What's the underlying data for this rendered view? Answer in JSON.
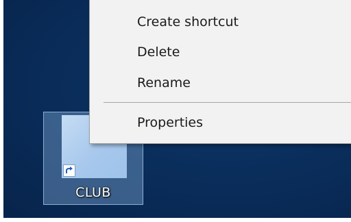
{
  "context_menu": {
    "items": [
      {
        "label": "Create shortcut"
      },
      {
        "label": "Delete"
      },
      {
        "label": "Rename"
      },
      {
        "label": "Properties"
      }
    ]
  },
  "desktop": {
    "icon": {
      "label": "CLUB",
      "overlay_icon": "shortcut-arrow-icon",
      "selected": true
    }
  },
  "colors": {
    "desktop_background": "#0a2e5c",
    "menu_background": "#f2f2f2",
    "selection": "#78a0cd"
  }
}
